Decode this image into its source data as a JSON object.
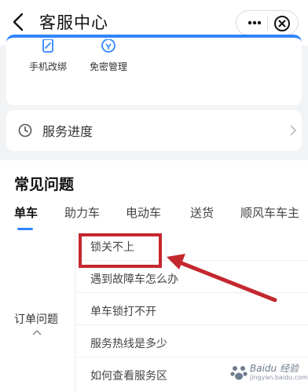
{
  "header": {
    "title": "客服中心"
  },
  "quick_actions": [
    {
      "label": "手机改绑",
      "icon": "edit-phone-icon"
    },
    {
      "label": "免密管理",
      "icon": "password-free-icon"
    }
  ],
  "progress": {
    "label": "服务进度"
  },
  "faq": {
    "title": "常见问题",
    "tabs": [
      {
        "label": "单车",
        "active": true
      },
      {
        "label": "助力车",
        "active": false
      },
      {
        "label": "电动车",
        "active": false
      },
      {
        "label": "送货",
        "active": false
      },
      {
        "label": "顺风车车主",
        "active": false
      }
    ],
    "category": {
      "label": "订单问题"
    },
    "questions": [
      {
        "label": "锁关不上"
      },
      {
        "label": "遇到故障车怎么办"
      },
      {
        "label": "单车锁打不开"
      },
      {
        "label": "服务热线是多少"
      },
      {
        "label": "如何查看服务区"
      }
    ]
  },
  "watermark": {
    "text": "Baidu 经验",
    "url": "jingyan.baidu.com"
  },
  "colors": {
    "accent": "#2f86ff",
    "highlight": "#c3282e"
  }
}
